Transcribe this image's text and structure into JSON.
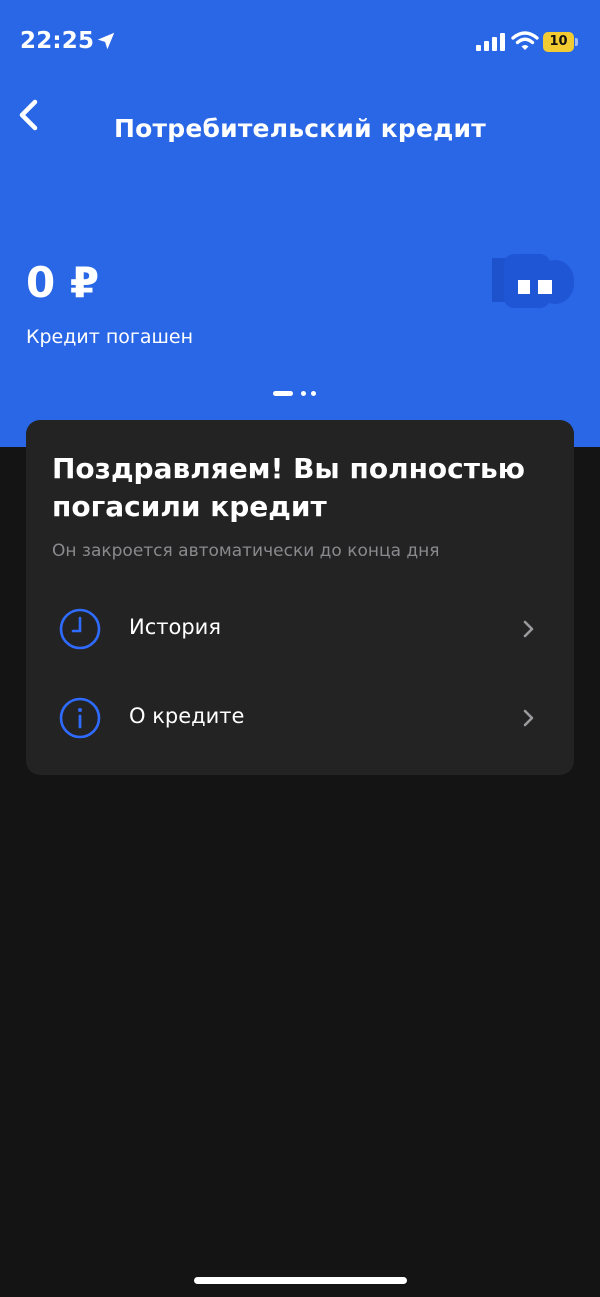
{
  "status_bar": {
    "time": "22:25",
    "battery_level": "10",
    "icons": [
      "location-arrow-icon",
      "cellular-signal-icon",
      "wifi-icon",
      "battery-charging-icon"
    ]
  },
  "header": {
    "title": "Потребительский кредит",
    "back_icon": "chevron-left-icon",
    "balance": "0 ₽",
    "status": "Кредит погашен",
    "accent_color": "#2A67E6",
    "pager": {
      "count": 3,
      "active_index": 0
    }
  },
  "card": {
    "title": "Поздравляем! Вы полностью погасили кредит",
    "subtitle": "Он закроется автоматически до конца дня",
    "items": [
      {
        "label": "История",
        "icon": "clock-icon"
      },
      {
        "label": "О кредите",
        "icon": "info-icon"
      }
    ]
  },
  "colors": {
    "background": "#141414",
    "card_background": "#232323",
    "icon_accent": "#2F6BFF"
  }
}
